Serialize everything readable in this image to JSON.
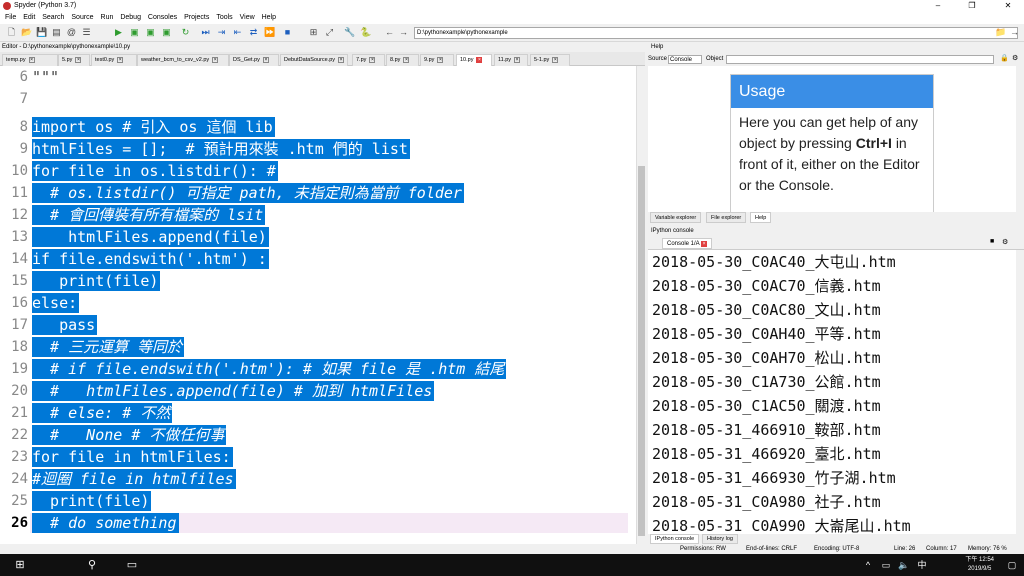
{
  "window": {
    "title": "Spyder (Python 3.7)"
  },
  "menu": [
    "File",
    "Edit",
    "Search",
    "Source",
    "Run",
    "Debug",
    "Consoles",
    "Projects",
    "Tools",
    "View",
    "Help"
  ],
  "path_box": "D:\\pythonexample\\pythonexample",
  "editor": {
    "title": "Editor - D:\\pythonexample\\pythonexample\\10.py",
    "tabs": [
      "temp.py",
      "5.py",
      "test0.py",
      "weather_bcm_to_csv_v2.py",
      "DS_Get.py",
      "DebutDataSource.py",
      "7.py",
      "8.py",
      "9.py",
      "10.py",
      "11.py",
      "5-1.py"
    ],
    "active_tab": "10.py",
    "lines": [
      {
        "n": "6",
        "text": "\"\"\"",
        "sel": false
      },
      {
        "n": "7",
        "text": "",
        "sel": false
      },
      {
        "n": "8",
        "text": "import os # 引入 os 這個 lib",
        "sel": true
      },
      {
        "n": "9",
        "text": "htmlFiles = [];  # 預計用來裝 .htm 們的 list",
        "sel": true
      },
      {
        "n": "10",
        "text": "for file in os.listdir(): #",
        "sel": true
      },
      {
        "n": "11",
        "text": "  # os.listdir() 可指定 path, 未指定則為當前 folder",
        "sel": true
      },
      {
        "n": "12",
        "text": "  # 會回傳裝有所有檔案的 lsit",
        "sel": true
      },
      {
        "n": "13",
        "text": "    htmlFiles.append(file)",
        "sel": true
      },
      {
        "n": "14",
        "text": "if file.endswith('.htm') :",
        "sel": true
      },
      {
        "n": "15",
        "text": "   print(file)",
        "sel": true
      },
      {
        "n": "16",
        "text": "else:",
        "sel": true
      },
      {
        "n": "17",
        "text": "   pass",
        "sel": true
      },
      {
        "n": "18",
        "text": "  # 三元運算 等同於",
        "sel": true
      },
      {
        "n": "19",
        "text": "  # if file.endswith('.htm'): # 如果 file 是 .htm 結尾",
        "sel": true
      },
      {
        "n": "20",
        "text": "  #   htmlFiles.append(file) # 加到 htmlFiles",
        "sel": true
      },
      {
        "n": "21",
        "text": "  # else: # 不然",
        "sel": true
      },
      {
        "n": "22",
        "text": "  #   None # 不做任何事",
        "sel": true
      },
      {
        "n": "23",
        "text": "for file in htmlFiles:",
        "sel": true
      },
      {
        "n": "24",
        "text": "#迴圈 file in htmlfiles",
        "sel": true
      },
      {
        "n": "25",
        "text": "  print(file)",
        "sel": true
      },
      {
        "n": "26",
        "text": "  # do something",
        "sel": true
      }
    ]
  },
  "help": {
    "title": "Help",
    "source_label": "Source",
    "source_value": "Console",
    "object_label": "Object",
    "usage_title": "Usage",
    "usage_text_1": "Here you can get help of any object by pressing",
    "usage_bold": "Ctrl+I",
    "usage_text_2": "in front of it, either on the Editor or the Console.",
    "tabs": [
      "Variable explorer",
      "File explorer",
      "Help"
    ]
  },
  "console": {
    "title": "IPython console",
    "tab": "Console 1/A",
    "lines": [
      "2018-05-30_C0AC40_大屯山.htm",
      "2018-05-30_C0AC70_信義.htm",
      "2018-05-30_C0AC80_文山.htm",
      "2018-05-30_C0AH40_平等.htm",
      "2018-05-30_C0AH70_松山.htm",
      "2018-05-30_C1A730_公館.htm",
      "2018-05-30_C1AC50_關渡.htm",
      "2018-05-31_466910_鞍部.htm",
      "2018-05-31_466920_臺北.htm",
      "2018-05-31_466930_竹子湖.htm",
      "2018-05-31_C0A980_社子.htm",
      "2018-05-31_C0A990_大崙尾山.htm"
    ],
    "bottom_tabs": [
      "IPython console",
      "History log"
    ]
  },
  "status": {
    "permissions": "Permissions: RW",
    "eol": "End-of-lines: CRLF",
    "encoding": "Encoding: UTF-8",
    "line": "Line: 26",
    "column": "Column: 17",
    "memory": "Memory: 76 %"
  },
  "taskbar": {
    "time": "下午 12:54",
    "date": "2019/9/5"
  }
}
